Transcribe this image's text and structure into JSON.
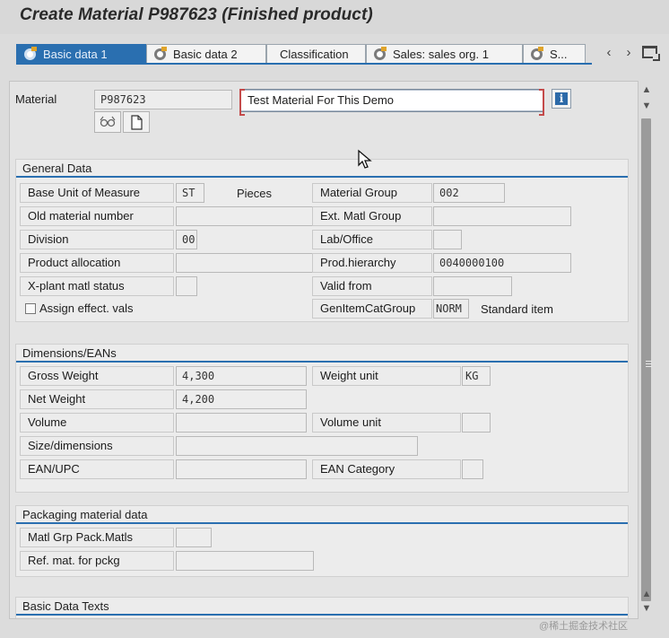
{
  "window": {
    "title": "Create Material P987623 (Finished product)"
  },
  "tabs": [
    {
      "label": "Basic data 1",
      "active": true
    },
    {
      "label": "Basic data 2"
    },
    {
      "label": "Classification"
    },
    {
      "label": "Sales: sales org. 1"
    },
    {
      "label": "S..."
    }
  ],
  "header": {
    "material_label": "Material",
    "material_value": "P987623",
    "description": "Test Material For This Demo"
  },
  "general_data": {
    "title": "General Data",
    "base_unit_label": "Base Unit of Measure",
    "base_unit_value": "ST",
    "base_unit_text": "Pieces",
    "material_group_label": "Material Group",
    "material_group_value": "002",
    "old_material_label": "Old material number",
    "old_material_value": "",
    "ext_matl_group_label": "Ext. Matl Group",
    "ext_matl_group_value": "",
    "division_label": "Division",
    "division_value": "00",
    "lab_office_label": "Lab/Office",
    "lab_office_value": "",
    "product_allocation_label": "Product allocation",
    "product_allocation_value": "",
    "prod_hierarchy_label": "Prod.hierarchy",
    "prod_hierarchy_value": "0040000100",
    "xplant_status_label": "X-plant matl status",
    "xplant_status_value": "",
    "valid_from_label": "Valid from",
    "valid_from_value": "",
    "assign_effect_label": "Assign effect. vals",
    "assign_effect_checked": false,
    "gen_item_cat_label": "GenItemCatGroup",
    "gen_item_cat_value": "NORM",
    "gen_item_cat_text": "Standard item"
  },
  "dimensions": {
    "title": "Dimensions/EANs",
    "gross_weight_label": "Gross Weight",
    "gross_weight_value": "4,300",
    "weight_unit_label": "Weight unit",
    "weight_unit_value": "KG",
    "net_weight_label": "Net Weight",
    "net_weight_value": "4,200",
    "volume_label": "Volume",
    "volume_value": "",
    "volume_unit_label": "Volume unit",
    "volume_unit_value": "",
    "size_label": "Size/dimensions",
    "size_value": "",
    "ean_label": "EAN/UPC",
    "ean_value": "",
    "ean_category_label": "EAN Category",
    "ean_category_value": ""
  },
  "packaging": {
    "title": "Packaging material data",
    "matl_grp_label": "Matl Grp Pack.Matls",
    "matl_grp_value": "",
    "ref_mat_label": "Ref. mat. for pckg",
    "ref_mat_value": ""
  },
  "basic_texts": {
    "title": "Basic Data Texts"
  },
  "watermark": "@稀土掘金技术社区",
  "colors": {
    "accent": "#2a6fb0",
    "panel": "#e4e4e4"
  }
}
